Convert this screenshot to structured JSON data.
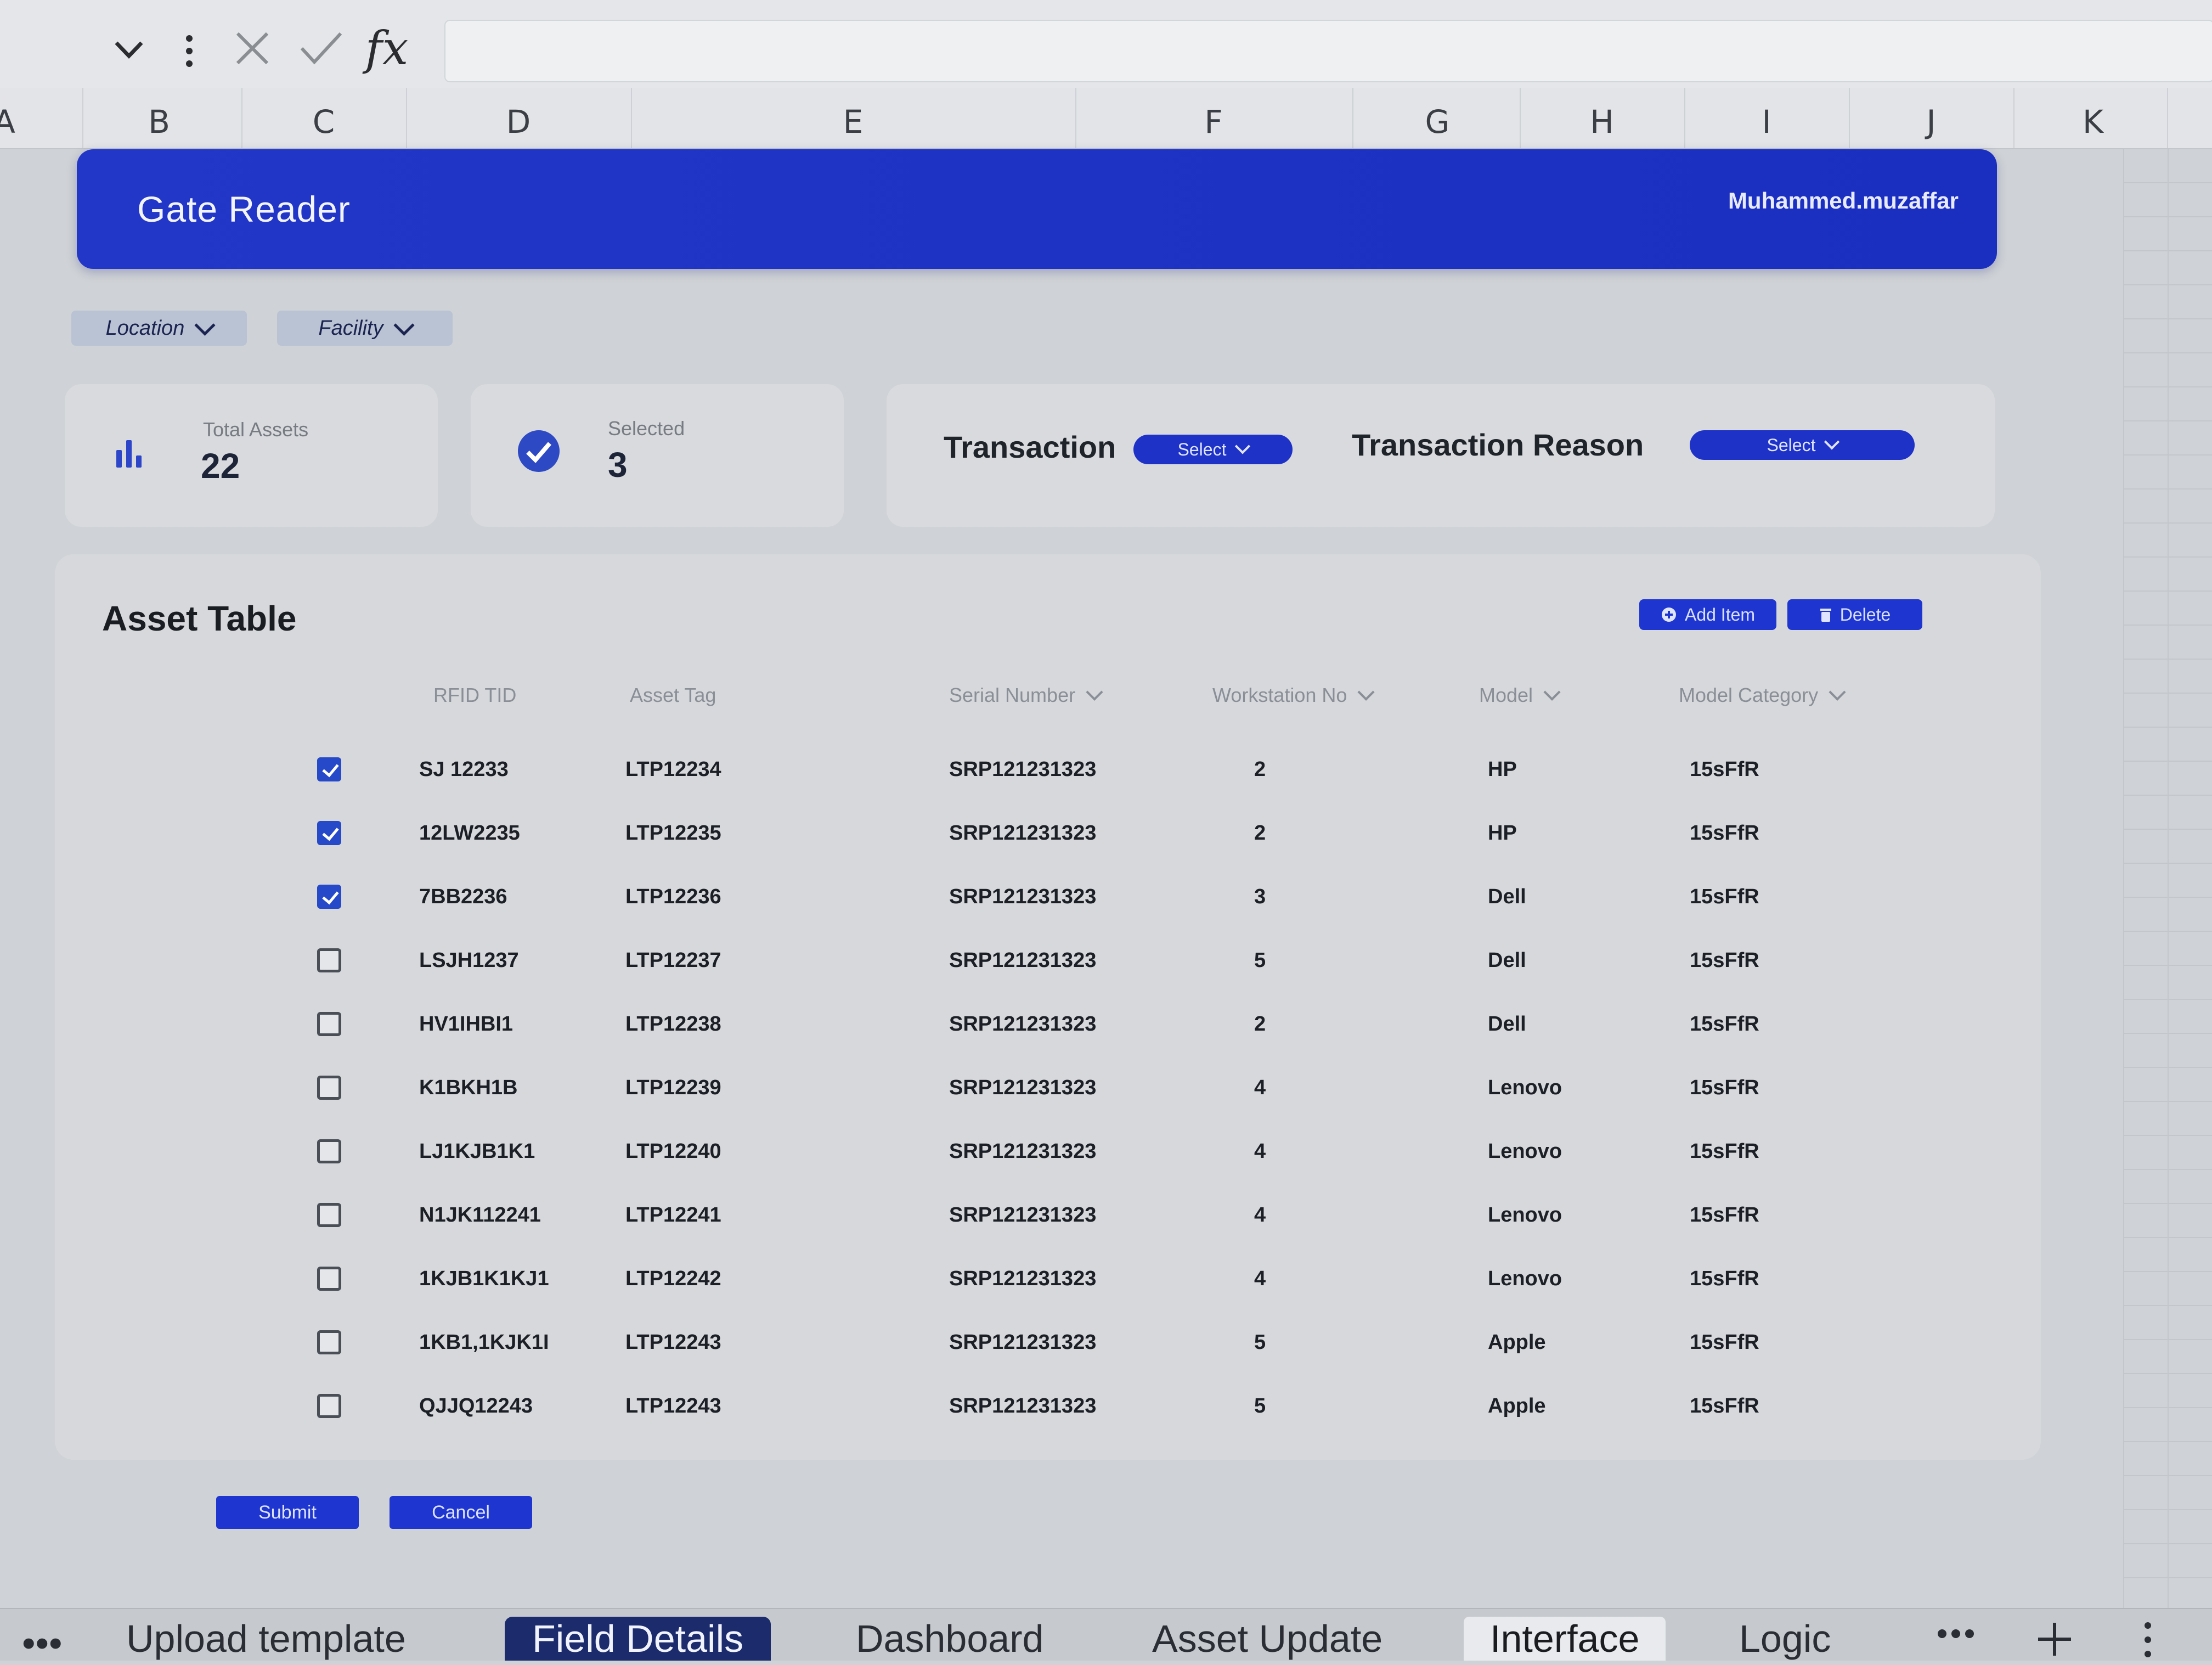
{
  "formula_bar": {
    "fx_label": "fx",
    "value": ""
  },
  "columns": [
    "A",
    "B",
    "C",
    "D",
    "E",
    "F",
    "G",
    "H",
    "I",
    "J",
    "K"
  ],
  "header": {
    "title": "Gate Reader",
    "user": "Muhammed.muzaffar"
  },
  "filters": {
    "location": "Location",
    "facility": "Facility"
  },
  "stats": {
    "total_assets_label": "Total Assets",
    "total_assets_value": "22",
    "selected_label": "Selected",
    "selected_value": "3"
  },
  "transaction": {
    "label": "Transaction",
    "select_label": "Select",
    "reason_label": "Transaction Reason",
    "reason_select_label": "Select"
  },
  "table": {
    "title": "Asset Table",
    "add_label": "Add Item",
    "delete_label": "Delete",
    "headers": {
      "rfid": "RFID TID",
      "asset_tag": "Asset Tag",
      "serial": "Serial Number",
      "workstation": "Workstation No",
      "model": "Model",
      "category": "Model Category"
    },
    "rows": [
      {
        "checked": true,
        "rfid": "SJ 12233",
        "tag": "LTP12234",
        "serial": "SRP121231323",
        "ws": "2",
        "model": "HP",
        "cat": "15sFfR"
      },
      {
        "checked": true,
        "rfid": "12LW2235",
        "tag": "LTP12235",
        "serial": "SRP121231323",
        "ws": "2",
        "model": "HP",
        "cat": "15sFfR"
      },
      {
        "checked": true,
        "rfid": "7BB2236",
        "tag": "LTP12236",
        "serial": "SRP121231323",
        "ws": "3",
        "model": "Dell",
        "cat": "15sFfR"
      },
      {
        "checked": false,
        "rfid": "LSJH1237",
        "tag": "LTP12237",
        "serial": "SRP121231323",
        "ws": "5",
        "model": "Dell",
        "cat": "15sFfR"
      },
      {
        "checked": false,
        "rfid": "HV1IHBI1",
        "tag": "LTP12238",
        "serial": "SRP121231323",
        "ws": "2",
        "model": "Dell",
        "cat": "15sFfR"
      },
      {
        "checked": false,
        "rfid": "K1BKH1B",
        "tag": "LTP12239",
        "serial": "SRP121231323",
        "ws": "4",
        "model": "Lenovo",
        "cat": "15sFfR"
      },
      {
        "checked": false,
        "rfid": "LJ1KJB1K1",
        "tag": "LTP12240",
        "serial": "SRP121231323",
        "ws": "4",
        "model": "Lenovo",
        "cat": "15sFfR"
      },
      {
        "checked": false,
        "rfid": "N1JK112241",
        "tag": "LTP12241",
        "serial": "SRP121231323",
        "ws": "4",
        "model": "Lenovo",
        "cat": "15sFfR"
      },
      {
        "checked": false,
        "rfid": "1KJB1K1KJ1",
        "tag": "LTP12242",
        "serial": "SRP121231323",
        "ws": "4",
        "model": "Lenovo",
        "cat": "15sFfR"
      },
      {
        "checked": false,
        "rfid": "1KB1,1KJK1I",
        "tag": "LTP12243",
        "serial": "SRP121231323",
        "ws": "5",
        "model": "Apple",
        "cat": "15sFfR"
      },
      {
        "checked": false,
        "rfid": "QJJQ12243",
        "tag": "LTP12243",
        "serial": "SRP121231323",
        "ws": "5",
        "model": "Apple",
        "cat": "15sFfR"
      }
    ]
  },
  "actions": {
    "submit": "Submit",
    "cancel": "Cancel"
  },
  "sheet_tabs": [
    "Upload template",
    "Field Details",
    "Dashboard",
    "Asset Update",
    "Interface",
    "Logic"
  ],
  "sheet_tabs_active": "Field Details",
  "sheet_tabs_current": "Interface",
  "colors": {
    "brand_blue": "#2236c8",
    "check_blue": "#2549c8",
    "panel": "#d6d8db"
  }
}
